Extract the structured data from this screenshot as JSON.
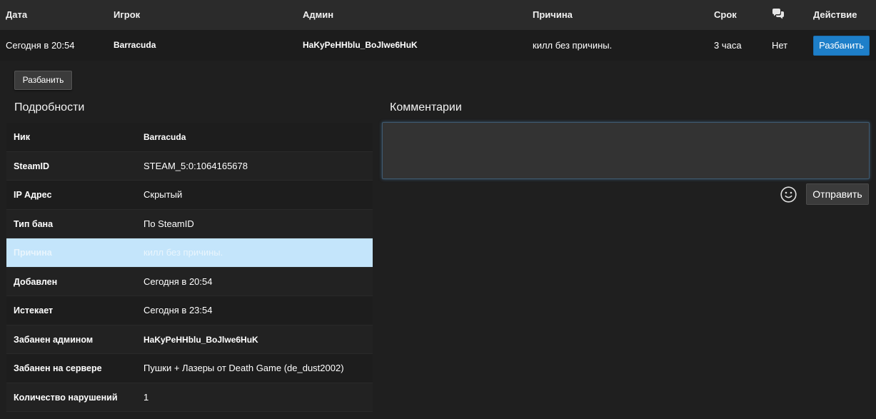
{
  "table": {
    "headers": {
      "date": "Дата",
      "player": "Игрок",
      "admin": "Админ",
      "reason": "Причина",
      "term": "Срок",
      "comments_icon": "comments-icon",
      "action": "Действие"
    },
    "row": {
      "date": "Сегодня в 20:54",
      "player": "Barracuda",
      "admin": "HaKyPeHHblu_BoJlwe6HuK",
      "reason": "килл без причины.",
      "term": "3 часа",
      "comments": "Нет",
      "unban_label": "Разбанить"
    }
  },
  "unban_button_label": "Разбанить",
  "details": {
    "title": "Подробности",
    "rows": [
      {
        "key": "Ник",
        "value": "Barracuda"
      },
      {
        "key": "SteamID",
        "value": "STEAM_5:0:1064165678"
      },
      {
        "key": "IP Адрес",
        "value": "Скрытый"
      },
      {
        "key": "Тип бана",
        "value": "По SteamID"
      },
      {
        "key": "Причина",
        "value": "килл без причины."
      },
      {
        "key": "Добавлен",
        "value": "Сегодня в 20:54"
      },
      {
        "key": "Истекает",
        "value": "Сегодня в 23:54"
      },
      {
        "key": "Забанен админом",
        "value": "HaKyPeHHblu_BoJlwe6HuK"
      },
      {
        "key": "Забанен на сервере",
        "value": "Пушки + Лазеры от Death Game (de_dust2002)"
      },
      {
        "key": "Количество нарушений",
        "value": "1"
      }
    ]
  },
  "comments": {
    "title": "Комментарии",
    "input_value": "",
    "emoji_icon": "smiley-icon",
    "send_label": "Отправить"
  },
  "colors": {
    "background": "#1f1f1f",
    "header_bg": "#2b2b2b",
    "accent_blue": "#1e7fc9",
    "highlight_row": "#c4e5fb"
  }
}
